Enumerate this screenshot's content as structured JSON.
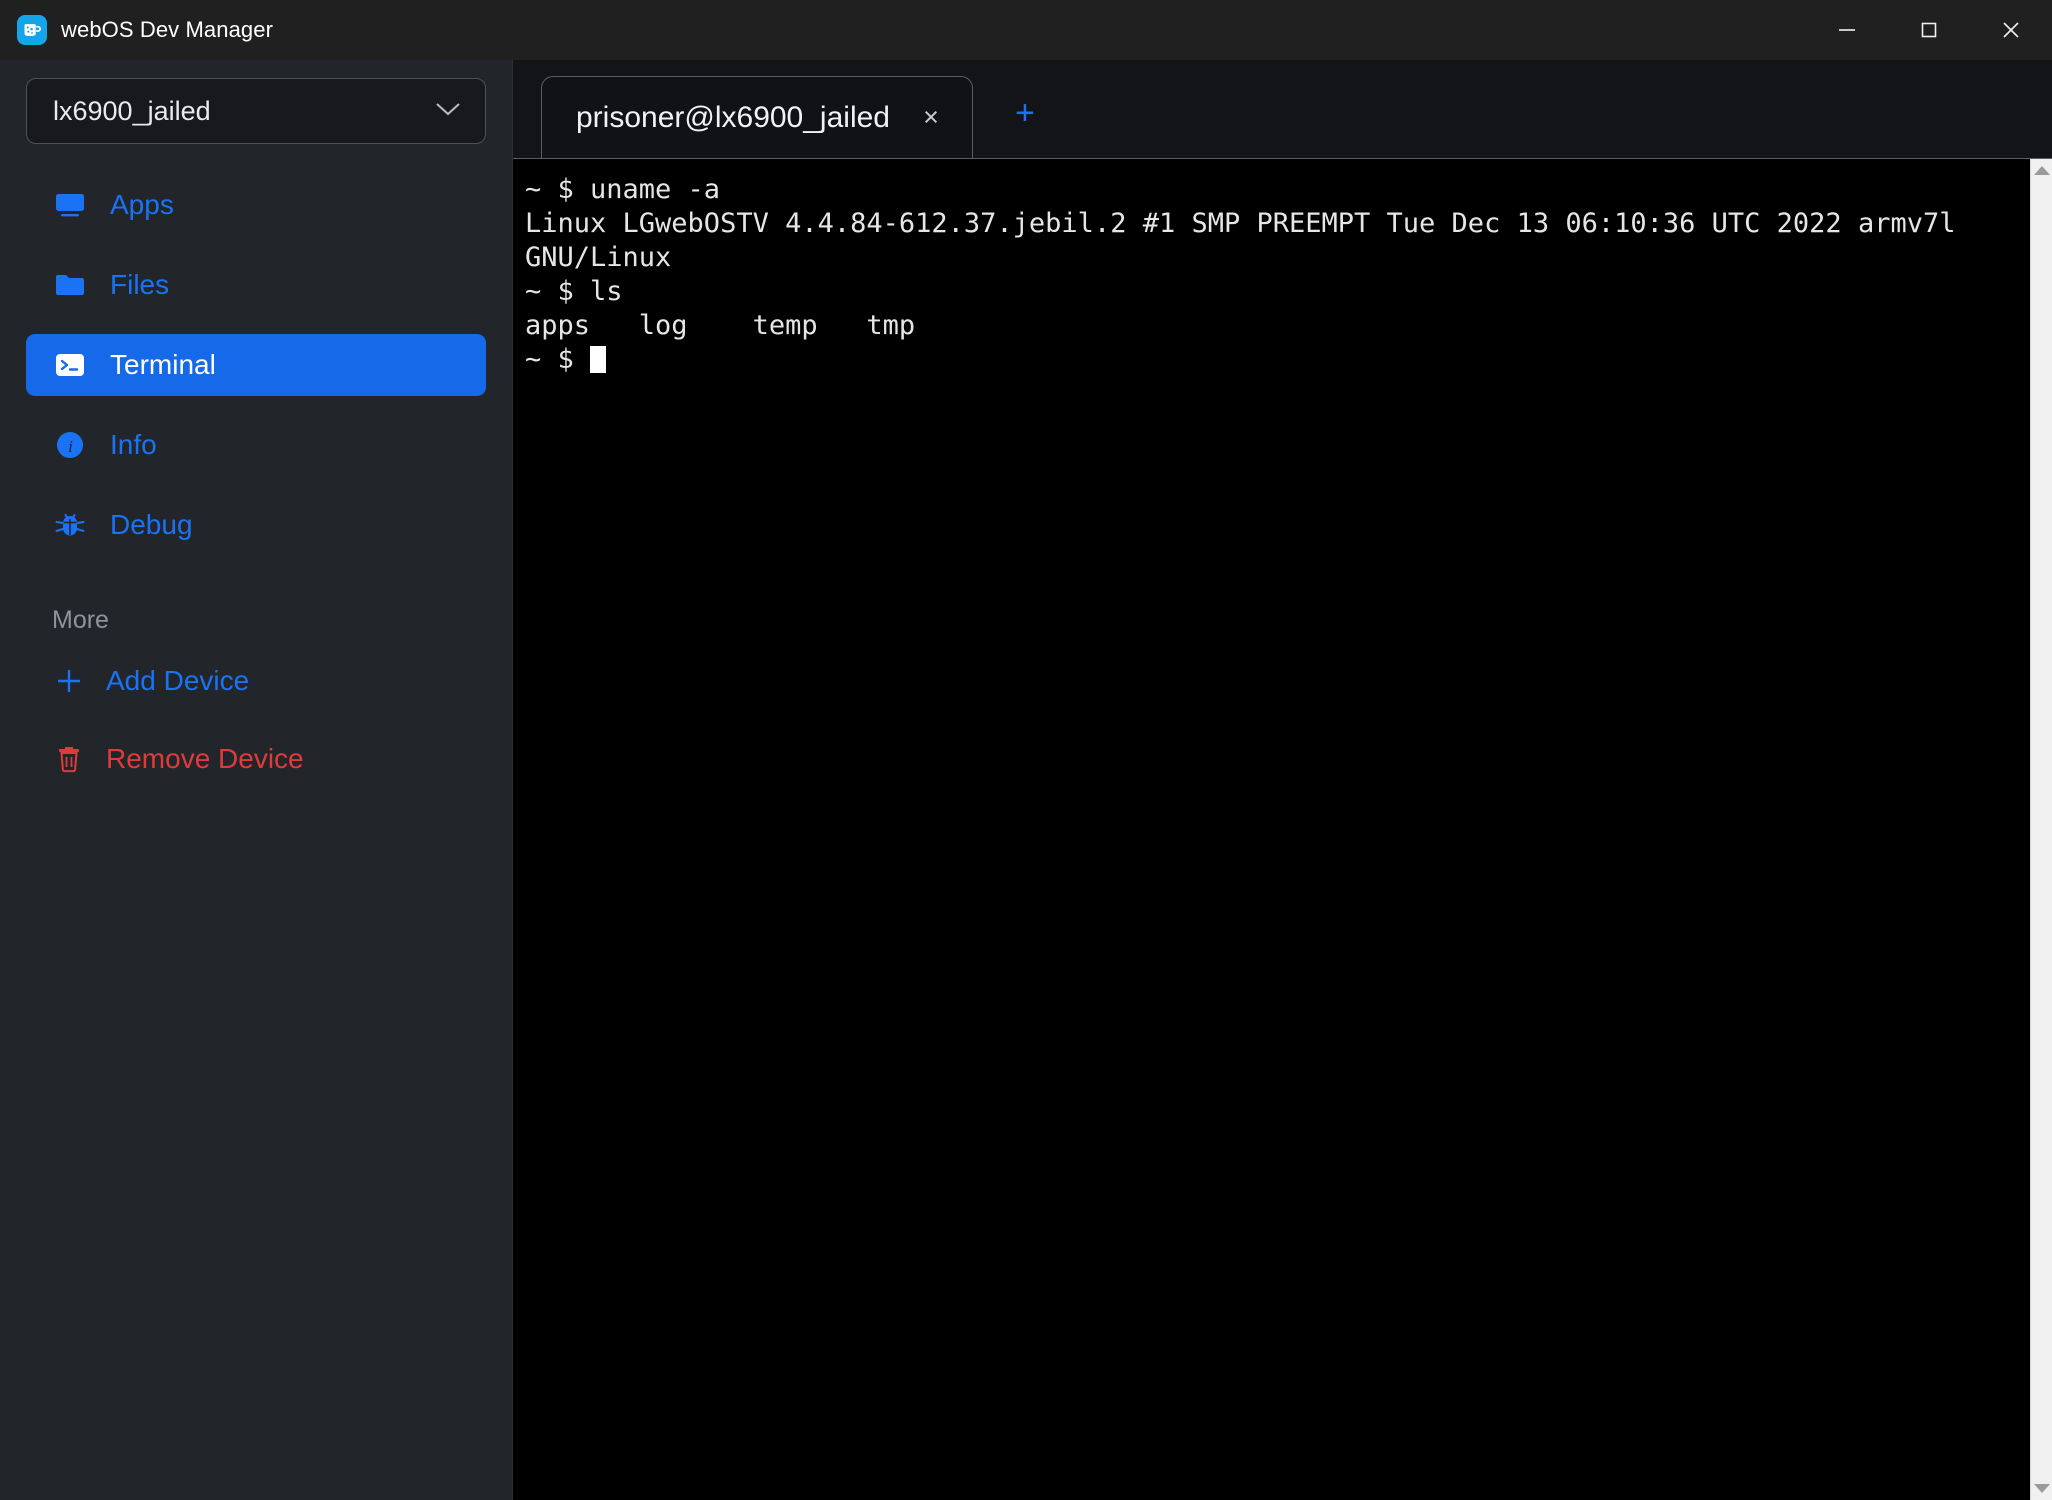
{
  "window": {
    "title": "webOS Dev Manager",
    "app_icon": "webos-mug-icon",
    "controls": {
      "minimize": "minimize-icon",
      "maximize": "maximize-icon",
      "close": "close-icon"
    }
  },
  "sidebar": {
    "device_select": {
      "value": "lx6900_jailed",
      "chevron": "chevron-down-icon"
    },
    "items": [
      {
        "label": "Apps",
        "icon": "monitor-icon",
        "active": false
      },
      {
        "label": "Files",
        "icon": "folder-icon",
        "active": false
      },
      {
        "label": "Terminal",
        "icon": "terminal-prompt-icon",
        "active": true
      },
      {
        "label": "Info",
        "icon": "info-circle-icon",
        "active": false
      },
      {
        "label": "Debug",
        "icon": "bug-icon",
        "active": false
      }
    ],
    "more": {
      "heading": "More",
      "items": [
        {
          "label": "Add Device",
          "icon": "plus-icon",
          "kind": "add"
        },
        {
          "label": "Remove Device",
          "icon": "trash-icon",
          "kind": "remove"
        }
      ]
    }
  },
  "main": {
    "tabs": [
      {
        "label": "prisoner@lx6900_jailed",
        "close": "×",
        "active": true
      }
    ],
    "new_tab": "+",
    "terminal": {
      "lines": [
        "~ $ uname -a",
        "Linux LGwebOSTV 4.4.84-612.37.jebil.2 #1 SMP PREEMPT Tue Dec 13 06:10:36 UTC 2022 armv7l GNU/Linux",
        "~ $ ls",
        "apps   log    temp   tmp",
        "~ $ "
      ],
      "text": "~ $ uname -a\nLinux LGwebOSTV 4.4.84-612.37.jebil.2 #1 SMP PREEMPT Tue Dec 13 06:10:36 UTC 2022 armv7l GNU/Linux\n~ $ ls\napps   log    temp   tmp\n~ $ "
    },
    "scrollbar": {
      "up": "scroll-up-arrow-icon",
      "down": "scroll-down-arrow-icon"
    }
  },
  "colors": {
    "accent_blue": "#1a73f5",
    "active_blue": "#1669e8",
    "danger_red": "#e03b3b",
    "sidebar_bg": "#22262b",
    "titlebar_bg": "#202020",
    "terminal_bg": "#000000",
    "app_icon_bg": "#14a4e8"
  }
}
